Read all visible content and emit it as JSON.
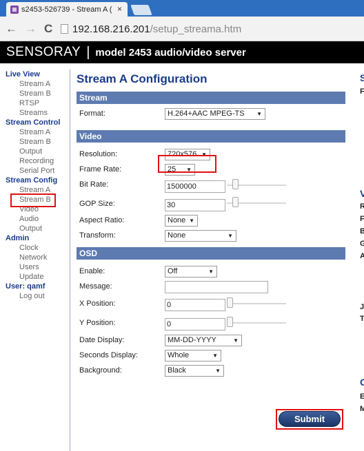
{
  "browser": {
    "tab_title": "s2453-526739 - Stream A (",
    "tab_close": "×",
    "url_host": "192.168.216.201",
    "url_path": "/setup_streama.htm",
    "back": "←",
    "forward": "→",
    "reload": "C"
  },
  "banner": {
    "brand": "SENSORAY",
    "separator": "|",
    "model": "model 2453 audio/video server"
  },
  "sidebar": {
    "live_view": {
      "head": "Live View",
      "items": [
        "Stream A",
        "Stream B",
        "RTSP Streams"
      ]
    },
    "stream_control": {
      "head": "Stream Control",
      "items": [
        "Stream A",
        "Stream B",
        "Output",
        "Recording",
        "Serial Port"
      ]
    },
    "stream_config": {
      "head": "Stream Config",
      "items": [
        "Stream A",
        "Stream B",
        "Video",
        "Audio",
        "Output"
      ]
    },
    "admin": {
      "head": "Admin",
      "items": [
        "Clock",
        "Network",
        "Users",
        "Update"
      ]
    },
    "user": {
      "head": "User: qamf",
      "items": [
        "Log out"
      ]
    }
  },
  "main": {
    "title": "Stream A Configuration",
    "stream": {
      "head": "Stream",
      "format_label": "Format:",
      "format_value": "H.264+AAC MPEG-TS"
    },
    "video": {
      "head": "Video",
      "resolution_label": "Resolution:",
      "resolution_value": "720x576",
      "frame_rate_label": "Frame Rate:",
      "frame_rate_value": "25",
      "bit_rate_label": "Bit Rate:",
      "bit_rate_value": "1500000",
      "gop_label": "GOP Size:",
      "gop_value": "30",
      "aspect_label": "Aspect Ratio:",
      "aspect_value": "None",
      "transform_label": "Transform:",
      "transform_value": "None"
    },
    "osd": {
      "head": "OSD",
      "enable_label": "Enable:",
      "enable_value": "Off",
      "message_label": "Message:",
      "message_value": "",
      "xpos_label": "X Position:",
      "xpos_value": "0",
      "ypos_label": "Y Position:",
      "ypos_value": "0",
      "date_label": "Date Display:",
      "date_value": "MM-DD-YYYY",
      "seconds_label": "Seconds Display:",
      "seconds_value": "Whole",
      "background_label": "Background:",
      "background_value": "Black"
    },
    "submit": "Submit"
  },
  "right_column": [
    "S",
    "F",
    "V",
    "R",
    "F",
    "B",
    "G",
    "A",
    "J",
    "T",
    "O",
    "E",
    "M"
  ],
  "colors": {
    "accent": "#1a3c8a",
    "section": "#5d7bb0",
    "highlight": "#e01010"
  }
}
